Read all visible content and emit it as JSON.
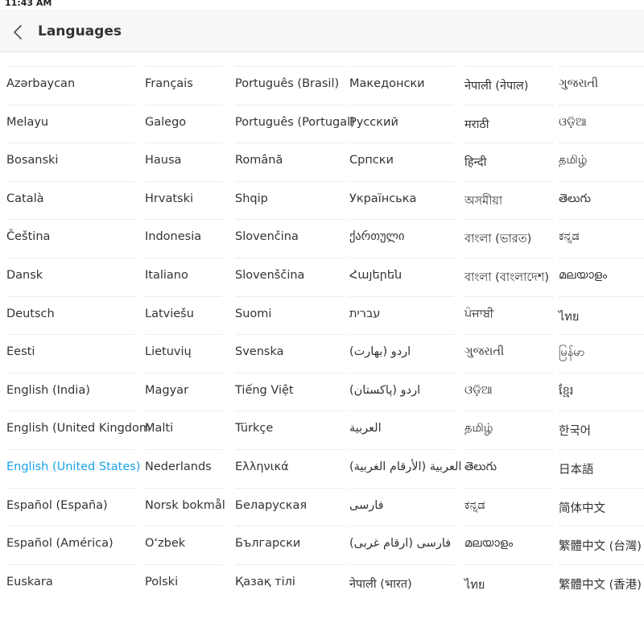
{
  "status_bar": {
    "time": "11:43 AM"
  },
  "header": {
    "title": "Languages",
    "back_icon": "chevron-left-icon"
  },
  "selected_language": "English (United States)",
  "accent_color": "#1aa3e8",
  "columns": [
    {
      "items": [
        {
          "label": "Azərbaycan",
          "selected": false
        },
        {
          "label": "Melayu",
          "selected": false
        },
        {
          "label": "Bosanski",
          "selected": false
        },
        {
          "label": "Català",
          "selected": false
        },
        {
          "label": "Čeština",
          "selected": false
        },
        {
          "label": "Dansk",
          "selected": false
        },
        {
          "label": "Deutsch",
          "selected": false
        },
        {
          "label": "Eesti",
          "selected": false
        },
        {
          "label": "English (India)",
          "selected": false
        },
        {
          "label": "English (United Kingdom",
          "selected": false
        },
        {
          "label": "English (United States)",
          "selected": true
        },
        {
          "label": "Español (España)",
          "selected": false
        },
        {
          "label": "Español (América)",
          "selected": false
        },
        {
          "label": "Euskara",
          "selected": false
        }
      ]
    },
    {
      "items": [
        {
          "label": "Français",
          "selected": false
        },
        {
          "label": "Galego",
          "selected": false
        },
        {
          "label": "Hausa",
          "selected": false
        },
        {
          "label": "Hrvatski",
          "selected": false
        },
        {
          "label": "Indonesia",
          "selected": false
        },
        {
          "label": "Italiano",
          "selected": false
        },
        {
          "label": "Latviešu",
          "selected": false
        },
        {
          "label": "Lietuvių",
          "selected": false
        },
        {
          "label": "Magyar",
          "selected": false
        },
        {
          "label": "Malti",
          "selected": false
        },
        {
          "label": "Nederlands",
          "selected": false
        },
        {
          "label": "Norsk bokmål",
          "selected": false
        },
        {
          "label": "O‘zbek",
          "selected": false
        },
        {
          "label": "Polski",
          "selected": false
        }
      ]
    },
    {
      "items": [
        {
          "label": "Português (Brasil)",
          "selected": false
        },
        {
          "label": "Português (Portugal)",
          "selected": false
        },
        {
          "label": "Română",
          "selected": false
        },
        {
          "label": "Shqip",
          "selected": false
        },
        {
          "label": "Slovenčina",
          "selected": false
        },
        {
          "label": "Slovenščina",
          "selected": false
        },
        {
          "label": "Suomi",
          "selected": false
        },
        {
          "label": "Svenska",
          "selected": false
        },
        {
          "label": "Tiếng Việt",
          "selected": false
        },
        {
          "label": "Türkçe",
          "selected": false
        },
        {
          "label": "Ελληνικά",
          "selected": false
        },
        {
          "label": "Беларуская",
          "selected": false
        },
        {
          "label": "Български",
          "selected": false
        },
        {
          "label": "Қазақ тілі",
          "selected": false
        }
      ]
    },
    {
      "items": [
        {
          "label": "Македонски",
          "selected": false
        },
        {
          "label": "Русский",
          "selected": false
        },
        {
          "label": "Српски",
          "selected": false
        },
        {
          "label": "Українська",
          "selected": false
        },
        {
          "label": "ქართული",
          "selected": false
        },
        {
          "label": "Հայերեն",
          "selected": false
        },
        {
          "label": "עברית",
          "selected": false
        },
        {
          "label": "اردو (بھارت)",
          "selected": false
        },
        {
          "label": "اردو (پاکستان)",
          "selected": false
        },
        {
          "label": "العربية",
          "selected": false
        },
        {
          "label": "العربية (الأرقام الغربية)",
          "selected": false
        },
        {
          "label": "فارسی",
          "selected": false
        },
        {
          "label": "فارسی (ارقام غربی)",
          "selected": false
        },
        {
          "label": "नेपाली (भारत)",
          "selected": false
        }
      ]
    },
    {
      "items": [
        {
          "label": "नेपाली (नेपाल)",
          "selected": false
        },
        {
          "label": "मराठी",
          "selected": false
        },
        {
          "label": "हिन्दी",
          "selected": false
        },
        {
          "label": "অসমীয়া",
          "selected": false
        },
        {
          "label": "বাংলা (ভারত)",
          "selected": false
        },
        {
          "label": "বাংলা (বাংলাদেশ)",
          "selected": false
        },
        {
          "label": "ਪੰਜਾਬੀ",
          "selected": false
        },
        {
          "label": "ગુજરાતી",
          "selected": false
        },
        {
          "label": "ଓଡ଼ିଆ",
          "selected": false
        },
        {
          "label": "தமிழ்",
          "selected": false
        },
        {
          "label": "తెలుగు",
          "selected": false
        },
        {
          "label": "ಕನ್ನಡ",
          "selected": false
        },
        {
          "label": "മലയാളം",
          "selected": false
        },
        {
          "label": "ไทย",
          "selected": false
        }
      ]
    },
    {
      "items": [
        {
          "label": "ગુજરાતી",
          "selected": false
        },
        {
          "label": "ଓଡ଼ିଆ",
          "selected": false
        },
        {
          "label": "தமிழ்",
          "selected": false
        },
        {
          "label": "తెలుగు",
          "selected": false
        },
        {
          "label": "ಕನ್ನಡ",
          "selected": false
        },
        {
          "label": "മലയാളം",
          "selected": false
        },
        {
          "label": "ไทย",
          "selected": false
        },
        {
          "label": "မြန်မာ",
          "selected": false
        },
        {
          "label": "ខ្មែរ",
          "selected": false
        },
        {
          "label": "한국어",
          "selected": false
        },
        {
          "label": "日本語",
          "selected": false
        },
        {
          "label": "简体中文",
          "selected": false
        },
        {
          "label": "繁體中文 (台灣)",
          "selected": false
        },
        {
          "label": "繁體中文 (香港)",
          "selected": false
        }
      ]
    }
  ]
}
